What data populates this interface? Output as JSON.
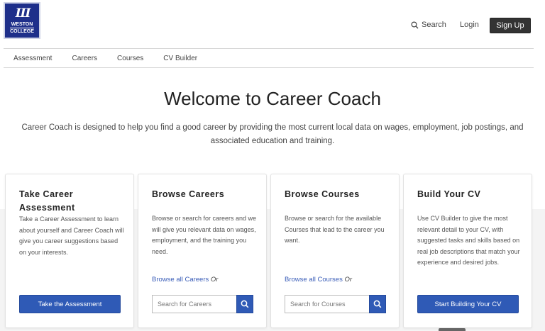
{
  "header": {
    "logo_mark": "Ш",
    "logo_line1": "WESTON",
    "logo_line2": "COLLEGE",
    "search_label": "Search",
    "login_label": "Login",
    "signup_label": "Sign Up"
  },
  "nav": {
    "items": [
      "Assessment",
      "Careers",
      "Courses",
      "CV Builder"
    ]
  },
  "main": {
    "title": "Welcome to Career Coach",
    "intro": "Career Coach is designed to help you find a good career by providing the most current local data on wages, employment, job postings, and associated education and training."
  },
  "cards": [
    {
      "title": "Take Career Assessment",
      "body": "Take a Career Assessment to learn about yourself and Career Coach will give you career suggestions based on your interests.",
      "button": "Take the Assessment"
    },
    {
      "title": "Browse Careers",
      "body": "Browse or search for careers and we will give you relevant data on wages, employment, and the training you need.",
      "browse_link": "Browse all Careers",
      "or": "Or",
      "search_placeholder": "Search for Careers"
    },
    {
      "title": "Browse Courses",
      "body": "Browse or search for the available Courses that lead to the career you want.",
      "browse_link": "Browse all Courses",
      "or": "Or",
      "search_placeholder": "Search for Courses"
    },
    {
      "title": "Build Your CV",
      "body": "Use CV Builder to give the most relevant detail to your CV, with suggested tasks and skills based on real job descriptions that match your experience and desired jobs.",
      "button": "Start Building Your CV"
    }
  ],
  "colors": {
    "brand": "#1e2f8a",
    "accent": "#2f5ab6",
    "link": "#3a5db8",
    "signup_bg": "#333333"
  },
  "icons": {
    "search": "search-icon"
  }
}
